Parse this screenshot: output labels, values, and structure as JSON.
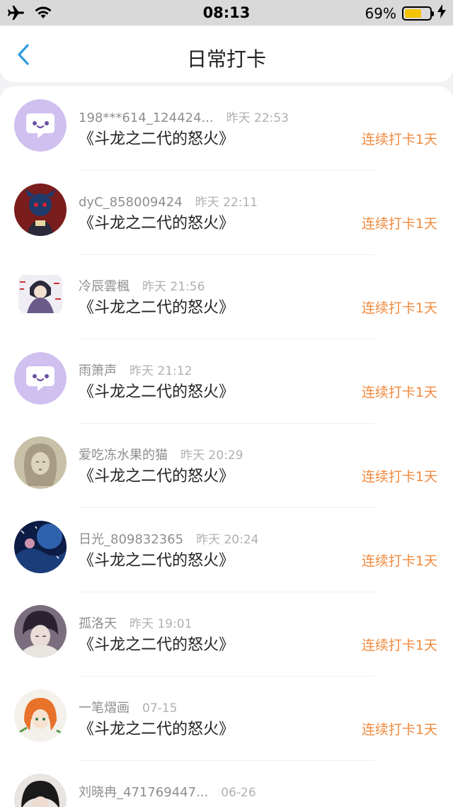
{
  "status_bar": {
    "time": "08:13",
    "battery": "69%",
    "battery_level": 0.69
  },
  "nav": {
    "title": "日常打卡",
    "back_icon": "chevron-left-icon"
  },
  "colors": {
    "accent": "#f08a3e",
    "back": "#2e9bde"
  },
  "entries": [
    {
      "name": "198***614_124424...",
      "time": "昨天 22:53",
      "book": "《斗龙之二代的怒火》",
      "streak": "连续打卡1天",
      "avatar": "chat-bubble-icon"
    },
    {
      "name": "dyC_858009424",
      "time": "昨天 22:11",
      "book": "《斗龙之二代的怒火》",
      "streak": "连续打卡1天",
      "avatar": "user-avatar"
    },
    {
      "name": "冷辰雲楓",
      "time": "昨天 21:56",
      "book": "《斗龙之二代的怒火》",
      "streak": "连续打卡1天",
      "avatar": "user-avatar"
    },
    {
      "name": "雨箫声",
      "time": "昨天 21:12",
      "book": "《斗龙之二代的怒火》",
      "streak": "连续打卡1天",
      "avatar": "chat-bubble-icon"
    },
    {
      "name": "爱吃冻水果的猫",
      "time": "昨天 20:29",
      "book": "《斗龙之二代的怒火》",
      "streak": "连续打卡1天",
      "avatar": "user-avatar"
    },
    {
      "name": "日光_809832365",
      "time": "昨天 20:24",
      "book": "《斗龙之二代的怒火》",
      "streak": "连续打卡1天",
      "avatar": "user-avatar"
    },
    {
      "name": "孤洛天",
      "time": "昨天 19:01",
      "book": "《斗龙之二代的怒火》",
      "streak": "连续打卡1天",
      "avatar": "user-avatar"
    },
    {
      "name": "一笔熠画",
      "time": "07-15",
      "book": "《斗龙之二代的怒火》",
      "streak": "连续打卡1天",
      "avatar": "user-avatar"
    },
    {
      "name": "刘晓冉_471769447...",
      "time": "06-26",
      "book": "",
      "streak": "",
      "avatar": "user-avatar"
    }
  ]
}
